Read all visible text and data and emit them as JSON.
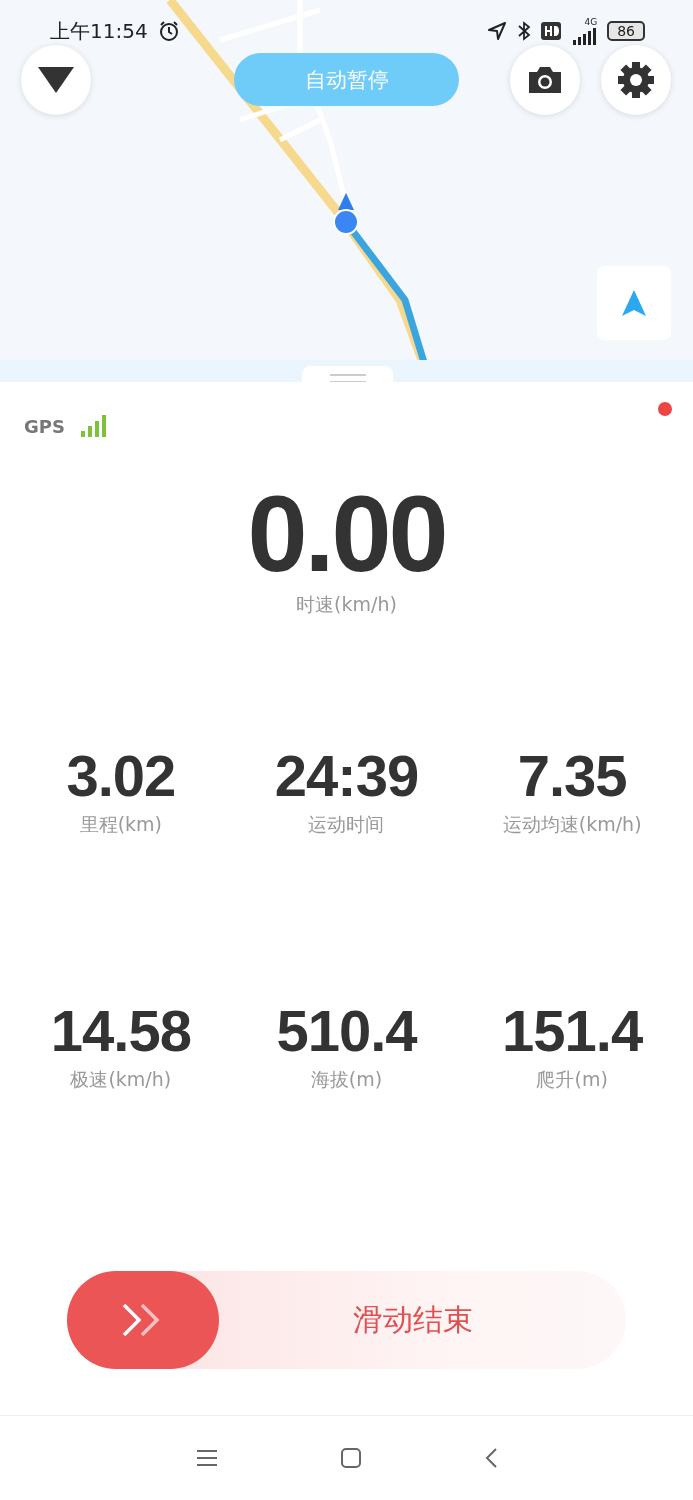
{
  "status_bar": {
    "time": "上午11:54",
    "network": "4G",
    "battery": "86"
  },
  "map": {
    "auto_pause_button": "自动暂停"
  },
  "gps": {
    "label": "GPS",
    "recording": true
  },
  "speed": {
    "value": "0.00",
    "label": "时速(km/h)"
  },
  "stats": [
    {
      "value": "3.02",
      "label": "里程(km)"
    },
    {
      "value": "24:39",
      "label": "运动时间"
    },
    {
      "value": "7.35",
      "label": "运动均速(km/h)"
    },
    {
      "value": "14.58",
      "label": "极速(km/h)"
    },
    {
      "value": "510.4",
      "label": "海拔(m)"
    },
    {
      "value": "151.4",
      "label": "爬升(m)"
    }
  ],
  "slider": {
    "label": "滑动结束"
  }
}
